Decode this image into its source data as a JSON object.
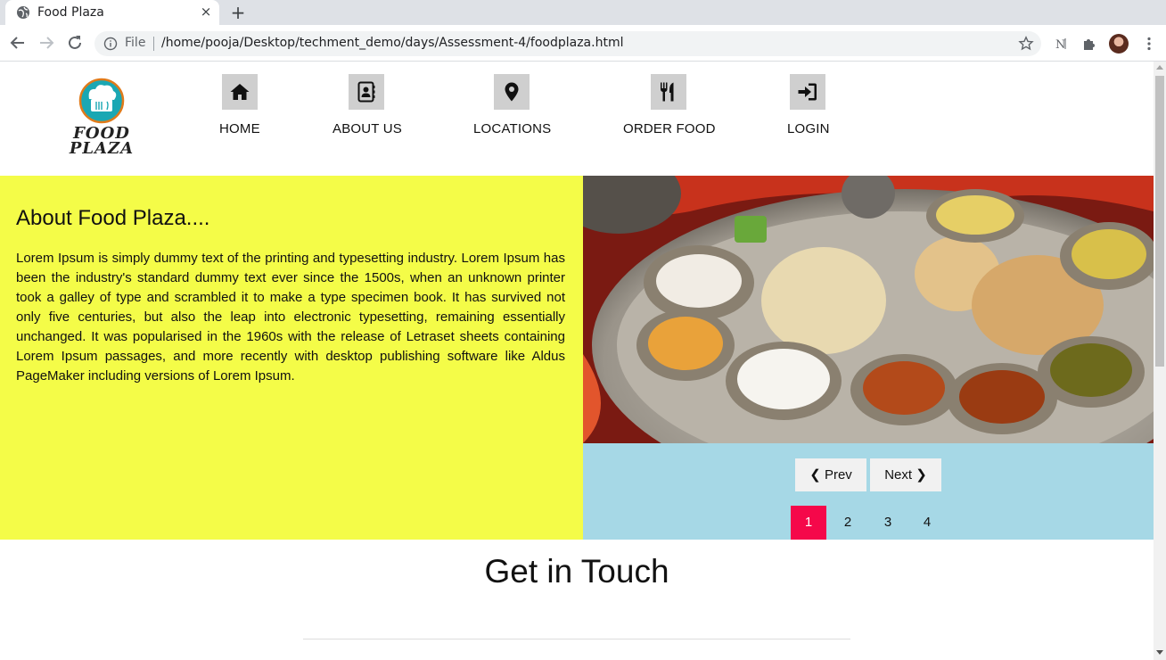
{
  "browser": {
    "tab_title": "Food Plaza",
    "tab_close_icon": "×",
    "new_tab_icon": "+",
    "address_prefix": "File",
    "url": "/home/pooja/Desktop/techment_demo/days/Assessment-4/foodplaza.html"
  },
  "logo": {
    "line1": "FOOD",
    "line2": "PLAZA"
  },
  "nav": {
    "items": [
      {
        "label": "HOME",
        "icon": "home-icon"
      },
      {
        "label": "ABOUT US",
        "icon": "address-book-icon"
      },
      {
        "label": "LOCATIONS",
        "icon": "map-marker-icon"
      },
      {
        "label": "ORDER FOOD",
        "icon": "utensils-icon"
      },
      {
        "label": "LOGIN",
        "icon": "sign-in-icon"
      }
    ]
  },
  "about": {
    "heading": "About Food Plaza....",
    "body": "Lorem Ipsum is simply dummy text of the printing and typesetting industry. Lorem Ipsum has been the industry's standard dummy text ever since the 1500s, when an unknown printer took a galley of type and scrambled it to make a type specimen book. It has survived not only five centuries, but also the leap into electronic typesetting, remaining essentially unchanged. It was popularised in the 1960s with the release of Letraset sheets containing Lorem Ipsum passages, and more recently with desktop publishing software like Aldus PageMaker including versions of Lorem Ipsum."
  },
  "slider": {
    "prev_label": "❮ Prev",
    "next_label": "Next ❯",
    "pages": [
      "1",
      "2",
      "3",
      "4"
    ],
    "active_page": "1"
  },
  "contact": {
    "heading": "Get in Touch"
  },
  "colors": {
    "about_bg": "#f4fc48",
    "slider_bg": "#a6d8e6",
    "active_page": "#f5084a",
    "nav_icon_bg": "#cfcfcf"
  }
}
